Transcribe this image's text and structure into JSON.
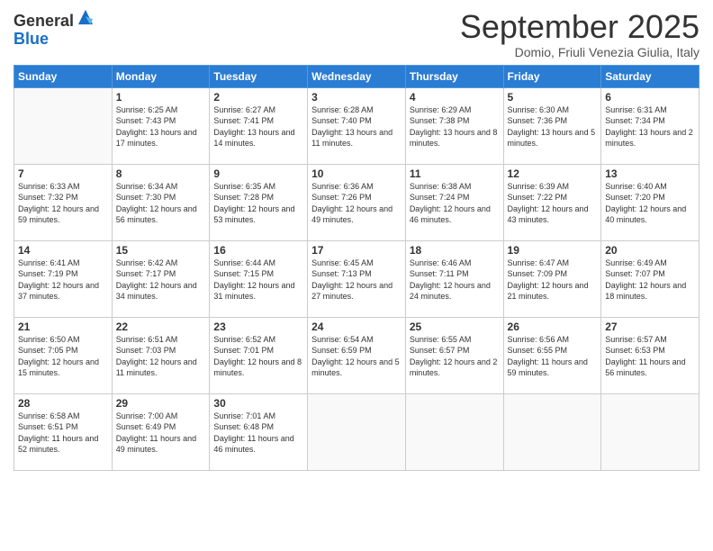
{
  "logo": {
    "general": "General",
    "blue": "Blue"
  },
  "title": "September 2025",
  "subtitle": "Domio, Friuli Venezia Giulia, Italy",
  "days_of_week": [
    "Sunday",
    "Monday",
    "Tuesday",
    "Wednesday",
    "Thursday",
    "Friday",
    "Saturday"
  ],
  "weeks": [
    [
      {
        "day": "",
        "info": ""
      },
      {
        "day": "1",
        "info": "Sunrise: 6:25 AM\nSunset: 7:43 PM\nDaylight: 13 hours\nand 17 minutes."
      },
      {
        "day": "2",
        "info": "Sunrise: 6:27 AM\nSunset: 7:41 PM\nDaylight: 13 hours\nand 14 minutes."
      },
      {
        "day": "3",
        "info": "Sunrise: 6:28 AM\nSunset: 7:40 PM\nDaylight: 13 hours\nand 11 minutes."
      },
      {
        "day": "4",
        "info": "Sunrise: 6:29 AM\nSunset: 7:38 PM\nDaylight: 13 hours\nand 8 minutes."
      },
      {
        "day": "5",
        "info": "Sunrise: 6:30 AM\nSunset: 7:36 PM\nDaylight: 13 hours\nand 5 minutes."
      },
      {
        "day": "6",
        "info": "Sunrise: 6:31 AM\nSunset: 7:34 PM\nDaylight: 13 hours\nand 2 minutes."
      }
    ],
    [
      {
        "day": "7",
        "info": "Sunrise: 6:33 AM\nSunset: 7:32 PM\nDaylight: 12 hours\nand 59 minutes."
      },
      {
        "day": "8",
        "info": "Sunrise: 6:34 AM\nSunset: 7:30 PM\nDaylight: 12 hours\nand 56 minutes."
      },
      {
        "day": "9",
        "info": "Sunrise: 6:35 AM\nSunset: 7:28 PM\nDaylight: 12 hours\nand 53 minutes."
      },
      {
        "day": "10",
        "info": "Sunrise: 6:36 AM\nSunset: 7:26 PM\nDaylight: 12 hours\nand 49 minutes."
      },
      {
        "day": "11",
        "info": "Sunrise: 6:38 AM\nSunset: 7:24 PM\nDaylight: 12 hours\nand 46 minutes."
      },
      {
        "day": "12",
        "info": "Sunrise: 6:39 AM\nSunset: 7:22 PM\nDaylight: 12 hours\nand 43 minutes."
      },
      {
        "day": "13",
        "info": "Sunrise: 6:40 AM\nSunset: 7:20 PM\nDaylight: 12 hours\nand 40 minutes."
      }
    ],
    [
      {
        "day": "14",
        "info": "Sunrise: 6:41 AM\nSunset: 7:19 PM\nDaylight: 12 hours\nand 37 minutes."
      },
      {
        "day": "15",
        "info": "Sunrise: 6:42 AM\nSunset: 7:17 PM\nDaylight: 12 hours\nand 34 minutes."
      },
      {
        "day": "16",
        "info": "Sunrise: 6:44 AM\nSunset: 7:15 PM\nDaylight: 12 hours\nand 31 minutes."
      },
      {
        "day": "17",
        "info": "Sunrise: 6:45 AM\nSunset: 7:13 PM\nDaylight: 12 hours\nand 27 minutes."
      },
      {
        "day": "18",
        "info": "Sunrise: 6:46 AM\nSunset: 7:11 PM\nDaylight: 12 hours\nand 24 minutes."
      },
      {
        "day": "19",
        "info": "Sunrise: 6:47 AM\nSunset: 7:09 PM\nDaylight: 12 hours\nand 21 minutes."
      },
      {
        "day": "20",
        "info": "Sunrise: 6:49 AM\nSunset: 7:07 PM\nDaylight: 12 hours\nand 18 minutes."
      }
    ],
    [
      {
        "day": "21",
        "info": "Sunrise: 6:50 AM\nSunset: 7:05 PM\nDaylight: 12 hours\nand 15 minutes."
      },
      {
        "day": "22",
        "info": "Sunrise: 6:51 AM\nSunset: 7:03 PM\nDaylight: 12 hours\nand 11 minutes."
      },
      {
        "day": "23",
        "info": "Sunrise: 6:52 AM\nSunset: 7:01 PM\nDaylight: 12 hours\nand 8 minutes."
      },
      {
        "day": "24",
        "info": "Sunrise: 6:54 AM\nSunset: 6:59 PM\nDaylight: 12 hours\nand 5 minutes."
      },
      {
        "day": "25",
        "info": "Sunrise: 6:55 AM\nSunset: 6:57 PM\nDaylight: 12 hours\nand 2 minutes."
      },
      {
        "day": "26",
        "info": "Sunrise: 6:56 AM\nSunset: 6:55 PM\nDaylight: 11 hours\nand 59 minutes."
      },
      {
        "day": "27",
        "info": "Sunrise: 6:57 AM\nSunset: 6:53 PM\nDaylight: 11 hours\nand 56 minutes."
      }
    ],
    [
      {
        "day": "28",
        "info": "Sunrise: 6:58 AM\nSunset: 6:51 PM\nDaylight: 11 hours\nand 52 minutes."
      },
      {
        "day": "29",
        "info": "Sunrise: 7:00 AM\nSunset: 6:49 PM\nDaylight: 11 hours\nand 49 minutes."
      },
      {
        "day": "30",
        "info": "Sunrise: 7:01 AM\nSunset: 6:48 PM\nDaylight: 11 hours\nand 46 minutes."
      },
      {
        "day": "",
        "info": ""
      },
      {
        "day": "",
        "info": ""
      },
      {
        "day": "",
        "info": ""
      },
      {
        "day": "",
        "info": ""
      }
    ]
  ]
}
